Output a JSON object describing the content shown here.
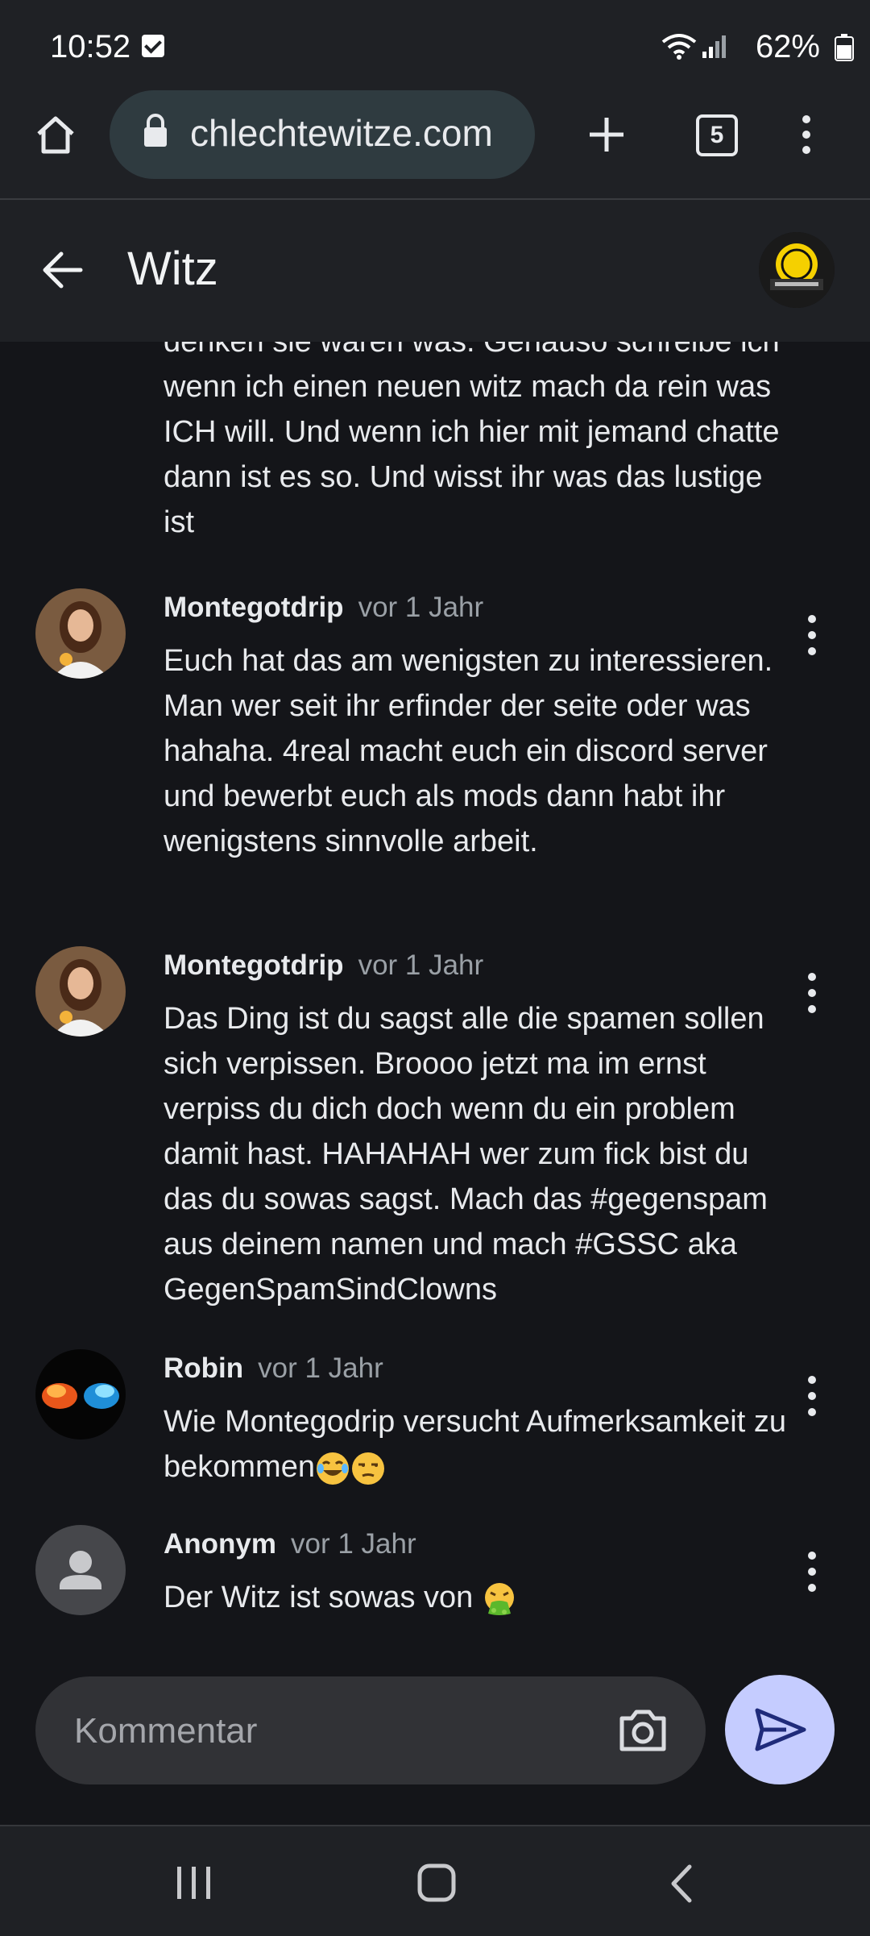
{
  "status_bar": {
    "time": "10:52",
    "battery": "62%"
  },
  "browser": {
    "url": "chlechtewitze.com",
    "tab_count": "5"
  },
  "app_bar": {
    "title": "Witz"
  },
  "comments": [
    {
      "body_visible": "denken sie wären was. Genauso schreibe ich wenn ich einen neuen witz mach da rein was ICH will. Und wenn ich hier mit jemand chatte dann ist es so. Und wisst ihr was das lustige ist"
    },
    {
      "author": "Montegotdrip",
      "time": "vor 1 Jahr",
      "body": "Euch hat das am wenigsten zu interessieren. Man wer seit ihr erfinder der seite oder was hahaha. 4real macht euch ein discord server und bewerbt euch als mods dann habt ihr wenigstens sinnvolle arbeit."
    },
    {
      "author": "Montegotdrip",
      "time": "vor 1 Jahr",
      "body": "Das Ding ist du sagst alle die spamen sollen sich verpissen. Broooo jetzt ma im ernst verpiss du dich doch wenn du ein problem damit hast. HAHAHAH wer zum fick bist du das du sowas sagst. Mach das #gegenspam aus deinem namen und mach #GSSC aka GegenSpamSindClowns"
    },
    {
      "author": "Robin",
      "time": "vor 1 Jahr",
      "body": "Wie Montegodrip versucht Aufmerksamkeit zu bekommen"
    },
    {
      "author": "Anonym",
      "time": "vor 1 Jahr",
      "body": "Der Witz ist sowas von "
    }
  ],
  "composer": {
    "placeholder": "Kommentar"
  },
  "colors": {
    "accent_send": "#c5ccff",
    "background": "#141519",
    "bars": "#1f2125"
  }
}
